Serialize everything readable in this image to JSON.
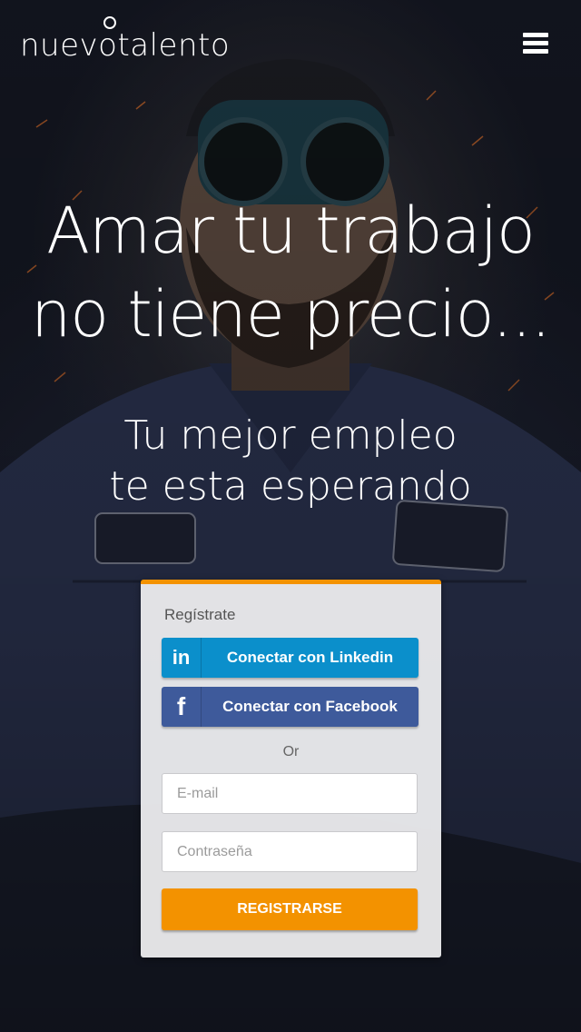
{
  "header": {
    "logo_text": "nuevotalento",
    "menu_icon": "hamburger-menu-icon"
  },
  "hero": {
    "headline_line1": "Amar tu trabajo",
    "headline_line2": "no tiene precio...",
    "subheadline_line1": "Tu mejor empleo",
    "subheadline_line2": "te esta esperando"
  },
  "signup": {
    "title": "Regístrate",
    "linkedin_icon_text": "in",
    "linkedin_label": "Conectar con Linkedin",
    "facebook_icon_text": "f",
    "facebook_label": "Conectar con Facebook",
    "or_label": "Or",
    "email_placeholder": "E-mail",
    "password_placeholder": "Contraseña",
    "submit_label": "REGISTRARSE"
  },
  "colors": {
    "accent": "#f39200",
    "linkedin": "#0b8fcb",
    "facebook": "#3e5a9b"
  }
}
